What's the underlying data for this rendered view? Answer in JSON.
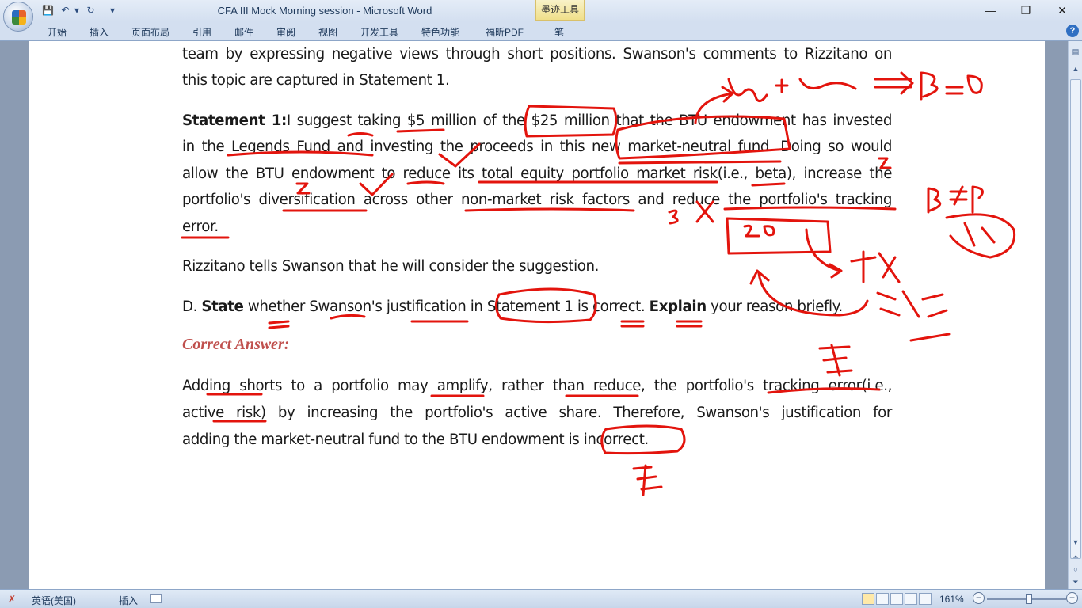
{
  "window": {
    "title": "CFA III Mock Morning session - Microsoft Word",
    "context_tab": "墨迹工具",
    "controls": {
      "minimize": "—",
      "restore": "❐",
      "close": "✕"
    }
  },
  "quick_access": {
    "save": "💾",
    "undo": "↶",
    "redo": "↻",
    "customize": "▾"
  },
  "ribbon": {
    "tabs": [
      "开始",
      "插入",
      "页面布局",
      "引用",
      "邮件",
      "审阅",
      "视图",
      "开发工具",
      "特色功能",
      "福昕PDF",
      "笔"
    ],
    "help": "?"
  },
  "document": {
    "intro_line1": "team by expressing negative views through short positions. Swanson's comments to Rizzitano on",
    "intro_line2": "this topic are captured in Statement 1.",
    "statement_label": "Statement 1:",
    "statement_line1": "I suggest taking $5 million of the $25 million that the BTU endowment has invested",
    "statement_line2": "in the Legends Fund and investing the proceeds in this new market-neutral fund. Doing so would",
    "statement_line3": "allow the BTU endowment to reduce its total equity portfolio market risk(i.e., beta), increase the",
    "statement_line4": "portfolio's diversification across other non-market risk factors and reduce the portfolio's tracking",
    "statement_line5": "error.",
    "rizzitano": "Rizzitano tells Swanson that he will consider the suggestion.",
    "question_prefix": "D. ",
    "question_state": "State",
    "question_mid": " whether Swanson's justification in Statement 1 is correct. ",
    "question_explain": "Explain",
    "question_end": " your reason briefly.",
    "answer_heading": "Correct Answer:",
    "answer_line1": "Adding shorts to a portfolio may amplify, rather than reduce, the portfolio's tracking error(i.e.,",
    "answer_line2": "active risk) by increasing the portfolio's active share. Therefore, Swanson's justification for",
    "answer_line3": "adding the market-neutral fund to the BTU endowment is incorrect."
  },
  "status_bar": {
    "language": "英语(美国)",
    "insert_mode": "插入",
    "zoom": "161%",
    "zoom_level_percent": 161
  },
  "ink_color": "#e3140d"
}
